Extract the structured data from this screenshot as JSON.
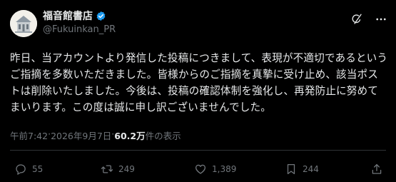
{
  "account": {
    "display_name": "福音館書店",
    "handle": "@Fukuinkan_PR"
  },
  "post": {
    "text": "昨日、当アカウントより発信した投稿につきまして、表現が不適切であるというご指摘を多数いただきました。皆様からのご指摘を真摯に受け止め、該当ポストは削除いたしました。今後は、投稿の確認体制を強化し、再発防止に努めてまいります。この度は誠に申し訳ございませんでした。",
    "time": "午前7:42",
    "separator": " · ",
    "date": "2026年9月7日",
    "views_count": "60.2万",
    "views_label": " 件の表示"
  },
  "stats": {
    "replies": "55",
    "reposts": "249",
    "likes": "1,389",
    "bookmarks": "244"
  },
  "icons": {
    "verified": "verified-badge-icon",
    "grok": "grok-icon",
    "more": "more-icon",
    "reply": "reply-icon",
    "repost": "repost-icon",
    "like": "like-icon",
    "bookmark": "bookmark-icon",
    "share": "share-icon"
  },
  "colors": {
    "verified": "#1d9bf0",
    "text": "#e7e9ea",
    "muted": "#71767b"
  }
}
